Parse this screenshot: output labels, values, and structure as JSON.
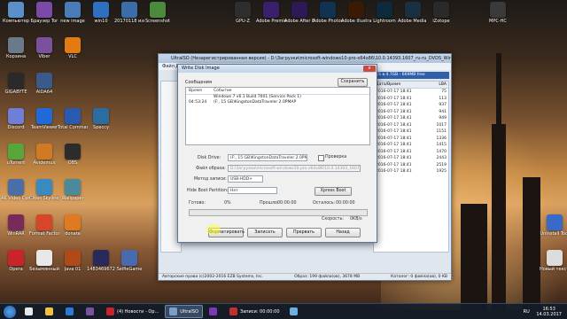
{
  "desktop": {
    "icons": [
      {
        "label": "Компьютер",
        "color": "#5b8fc9",
        "col": 0,
        "row": 0
      },
      {
        "label": "Браузер Tor",
        "color": "#7a4aa6",
        "col": 1,
        "row": 0
      },
      {
        "label": "new image",
        "color": "#4a7ab8",
        "col": 2,
        "row": 0
      },
      {
        "label": "win10",
        "color": "#2f6fc0",
        "col": 3,
        "row": 0
      },
      {
        "label": "20170118 изображ",
        "color": "#3b6ea8",
        "col": 4,
        "row": 0
      },
      {
        "label": "Screenshot",
        "color": "#4b8a3a",
        "col": 5,
        "row": 0
      },
      {
        "label": "GPU-Z",
        "color": "#2e2e2e",
        "col": 8,
        "row": 0
      },
      {
        "label": "Adobe Premiere P",
        "color": "#3a1f6b",
        "col": 9,
        "row": 0
      },
      {
        "label": "Adobe After Effects",
        "color": "#2d1a55",
        "col": 10,
        "row": 0
      },
      {
        "label": "Adobe Photoshop",
        "color": "#0f3350",
        "col": 11,
        "row": 0
      },
      {
        "label": "Adobe Illustrator",
        "color": "#3a1a05",
        "col": 12,
        "row": 0
      },
      {
        "label": "Lightroom",
        "color": "#0d2a3d",
        "col": 13,
        "row": 0
      },
      {
        "label": "Adobe Media Encoder",
        "color": "#183042",
        "col": 14,
        "row": 0
      },
      {
        "label": "iZotope",
        "color": "#2a2a2a",
        "col": 15,
        "row": 0
      },
      {
        "label": "MPC-HC",
        "color": "#3a3a3a",
        "col": 17,
        "row": 0
      },
      {
        "label": "Корзина",
        "color": "#6a7a8a",
        "col": 0,
        "row": 1
      },
      {
        "label": "Viber",
        "color": "#7b519d",
        "col": 1,
        "row": 1
      },
      {
        "label": "VLC",
        "color": "#e47a12",
        "col": 2,
        "row": 1
      },
      {
        "label": "GIGABYTE",
        "color": "#2a2a2a",
        "col": 0,
        "row": 2
      },
      {
        "label": "AIDA64",
        "color": "#3a5a8a",
        "col": 1,
        "row": 2
      },
      {
        "label": "Discord",
        "color": "#6f7ed6",
        "col": 0,
        "row": 3
      },
      {
        "label": "TeamViewer",
        "color": "#1f6ad8",
        "col": 1,
        "row": 3
      },
      {
        "label": "Total Commander",
        "color": "#2a5ab0",
        "col": 2,
        "row": 3
      },
      {
        "label": "Speccy",
        "color": "#2b6da0",
        "col": 3,
        "row": 3
      },
      {
        "label": "uTorrent",
        "color": "#57a63a",
        "col": 0,
        "row": 4
      },
      {
        "label": "Avidemux",
        "color": "#d07a25",
        "col": 1,
        "row": 4
      },
      {
        "label": "OBS",
        "color": "#2c2c2c",
        "col": 2,
        "row": 4
      },
      {
        "label": "AK Video Converter",
        "color": "#4a6ea8",
        "col": 0,
        "row": 5
      },
      {
        "label": "Cities Skylines",
        "color": "#3a8ac2",
        "col": 1,
        "row": 5
      },
      {
        "label": "Wallpaper",
        "color": "#4a8a9a",
        "col": 2,
        "row": 5
      },
      {
        "label": "WinRAR",
        "color": "#7a2a5a",
        "col": 0,
        "row": 6
      },
      {
        "label": "Format Factory",
        "color": "#d8462a",
        "col": 1,
        "row": 6
      },
      {
        "label": "donate",
        "color": "#e07a20",
        "col": 2,
        "row": 6
      },
      {
        "label": "Opera",
        "color": "#c9232c",
        "col": 0,
        "row": 7
      },
      {
        "label": "Безымянный",
        "color": "#e8e8e8",
        "col": 1,
        "row": 7
      },
      {
        "label": "Java 01",
        "color": "#b04a1a",
        "col": 2,
        "row": 7
      },
      {
        "label": "1483469672",
        "color": "#2a2a5a",
        "col": 3,
        "row": 7
      },
      {
        "label": "SelfieGame",
        "color": "#4a6ab0",
        "col": 4,
        "row": 7
      },
      {
        "label": "Uninstall Tool",
        "color": "#3a6ac8",
        "col": 19,
        "row": 6
      },
      {
        "label": "Новый текстов",
        "color": "#dcdcdc",
        "col": 19,
        "row": 7
      }
    ]
  },
  "main_window": {
    "title": "UltraISO (Незарегистрированная версия) - D:\\Загрузки\\microsoft-windows10-pro-x64x86\\10.0.14393.1607_ru-ru_DVDS_Win...",
    "menu": "Файл  Действия  Самозагрузка  Инструменты  Опции  Помощь",
    "right_strip": "IES в 4.7GB - 669MB free",
    "right_header": {
      "col1": "Дата/Время",
      "col2": "LBA"
    },
    "right_rows": [
      {
        "date": "2016-07-17 18:41",
        "lba": "75"
      },
      {
        "date": "2016-07-17 18:41",
        "lba": "113"
      },
      {
        "date": "2016-07-17 18:41",
        "lba": "937"
      },
      {
        "date": "2016-07-17 18:41",
        "lba": "941"
      },
      {
        "date": "2016-07-17 18:41",
        "lba": "949"
      },
      {
        "date": "2016-07-17 18:41",
        "lba": "1017"
      },
      {
        "date": "2016-07-17 18:41",
        "lba": "1151"
      },
      {
        "date": "2016-07-17 18:41",
        "lba": "1336"
      },
      {
        "date": "2016-07-17 18:41",
        "lba": "1415"
      },
      {
        "date": "2016-07-17 18:41",
        "lba": "1470"
      },
      {
        "date": "2016-07-17 18:41",
        "lba": "2443"
      },
      {
        "date": "2016-07-17 18:41",
        "lba": "2519"
      },
      {
        "date": "2016-07-17 18:41",
        "lba": "1925"
      }
    ],
    "status_left": "Авторские права (c)2002-2016 EZB Systems, Inc.",
    "status_mid": "Образ: 199 файла(ов), 3678 MB",
    "status_right": "Каталог: 0 файла(ов), 0 KB"
  },
  "dialog": {
    "title": "Write Disk Image",
    "close": "x",
    "messages_label": "Сообщения",
    "save_button": "Сохранить",
    "log_header": {
      "time": "Время",
      "event": "Событие"
    },
    "log_rows": [
      {
        "time": "",
        "event": "Windows 7 v6.1 Build 7601 (Service Pack 1)"
      },
      {
        "time": "04:53:24",
        "event": "(F:, 15 GB)KingstonDataTraveler 2.0PMAP"
      }
    ],
    "disk_drive_label": "Disk Drive:",
    "disk_drive_value": "(F:, 15 GB)KingstonDataTraveler 2.0PMAP",
    "verify_label": "Проверка",
    "image_file_label": "Файл образа:",
    "image_file_value": "D:\\Загрузки\\microsoft-windows10-pro-x64x86\\10.0.14393_1607_ru-ru\\Wi...",
    "write_method_label": "Метод записи:",
    "write_method_value": "USB-HDD+",
    "hide_boot_label": "Hide Boot Partition:",
    "hide_boot_value": "Нет",
    "xpress_boot_button": "Xpress Boot",
    "done_label": "Готово:",
    "done_value": "0%",
    "elapsed_label": "Прошло:",
    "elapsed_value": "00:00:00",
    "remaining_label": "Осталось:",
    "remaining_value": "00:00:00",
    "speed_label": "Скорость:",
    "speed_value": "0KB/s",
    "format_button": "Форматировать",
    "write_button": "Записать",
    "stop_button": "Прервать",
    "back_button": "Назад"
  },
  "taskbar": {
    "items": [
      {
        "label": "",
        "color": "#e8e8e8",
        "active": false
      },
      {
        "label": "",
        "color": "#f0c040",
        "active": false
      },
      {
        "label": "",
        "color": "#2a7ad8",
        "active": false
      },
      {
        "label": "",
        "color": "#7b519d",
        "active": false
      },
      {
        "label": "(4) Новости - Op...",
        "color": "#c9232c",
        "active": false
      },
      {
        "label": "UltraISO",
        "color": "#7aa0c8",
        "active": true
      },
      {
        "label": "",
        "color": "#7a3ab8",
        "active": false
      },
      {
        "label": "Записи: 00:00:00",
        "color": "#c03030",
        "active": false
      },
      {
        "label": "",
        "color": "#6ab0e0",
        "active": false
      }
    ],
    "lang": "RU",
    "time": "16:53",
    "date": "14.03.2017"
  }
}
